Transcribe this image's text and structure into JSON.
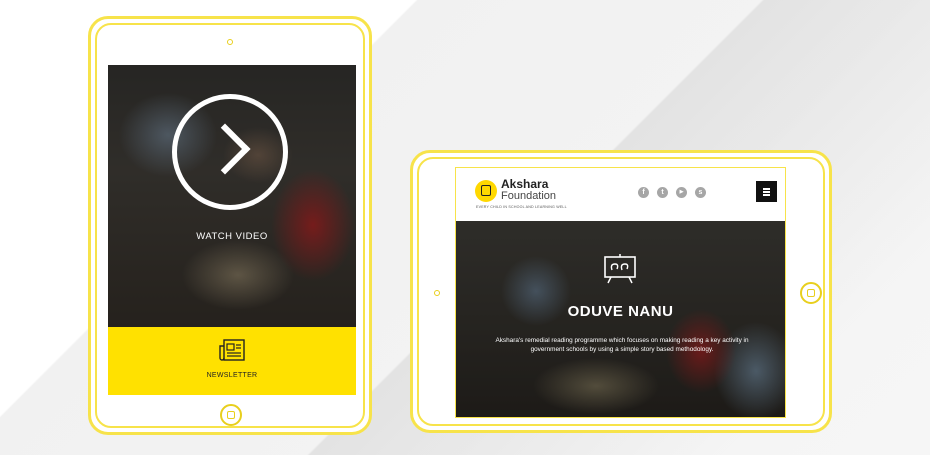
{
  "portrait": {
    "video_label": "WATCH VIDEO",
    "newsletter_label": "NEWSLETTER"
  },
  "landscape": {
    "logo_title": "Akshara",
    "logo_subtitle": "Foundation",
    "logo_tagline": "EVERY CHILD IN SCHOOL AND LEARNING WELL",
    "social_icons": [
      {
        "name": "facebook-icon",
        "glyph": "f"
      },
      {
        "name": "twitter-icon",
        "glyph": "t"
      },
      {
        "name": "youtube-icon",
        "glyph": "▶"
      },
      {
        "name": "skype-icon",
        "glyph": "s"
      }
    ],
    "hero_title": "ODUVE NANU",
    "hero_description": "Akshara's remedial reading programme which focuses on making reading a key activity in government schools by using a simple story based methodology."
  },
  "colors": {
    "accent": "#ffe100",
    "device_outline": "#f7e34a",
    "menu_button": "#111111",
    "social_icon": "#a6a6a6"
  }
}
